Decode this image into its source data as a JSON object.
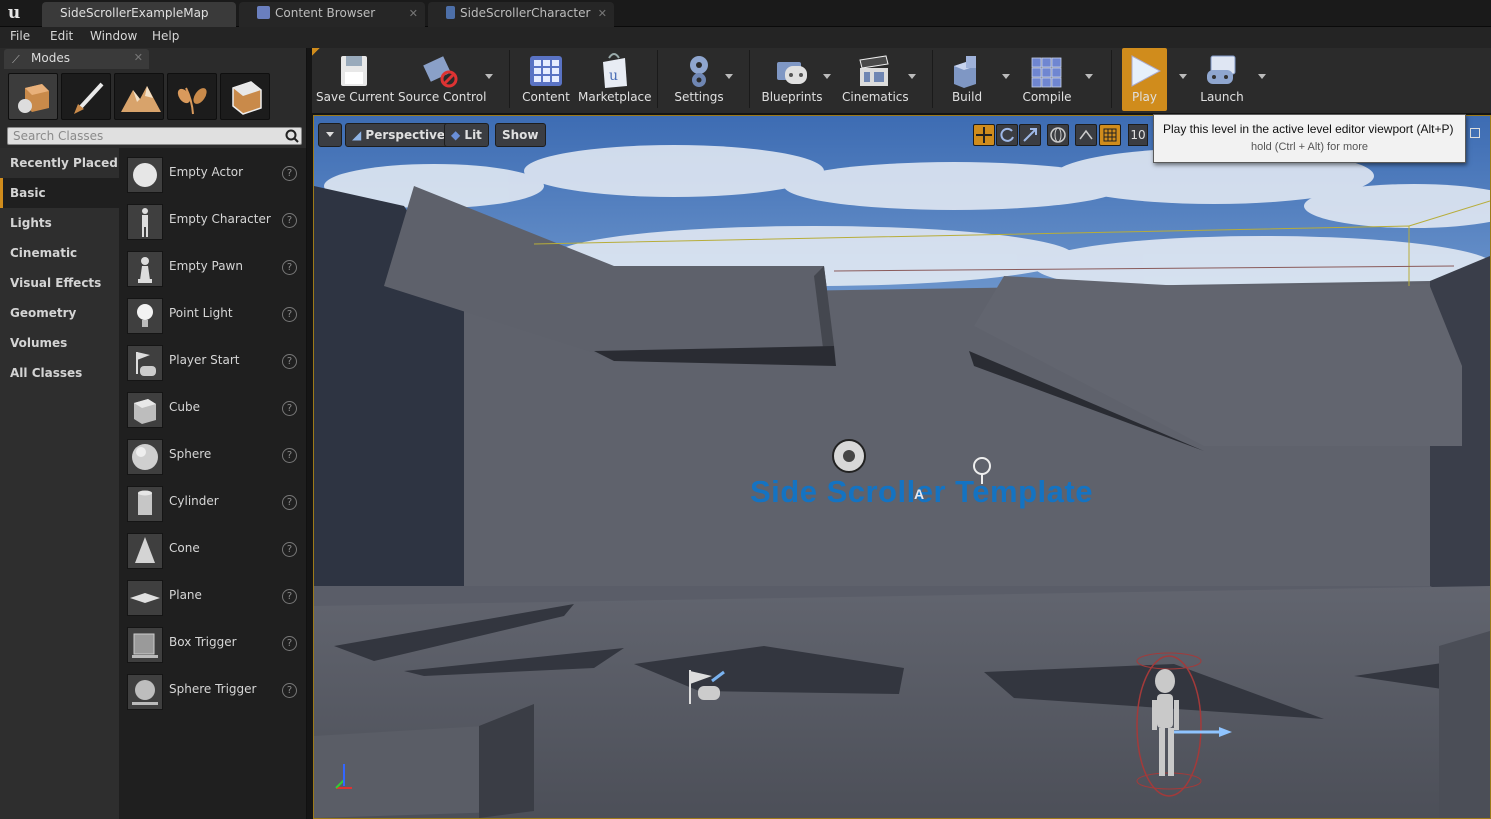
{
  "tabs": [
    {
      "label": "SideScrollerExampleMap",
      "active": true
    },
    {
      "label": "Content Browser",
      "active": false
    },
    {
      "label": "SideScrollerCharacter",
      "active": false
    }
  ],
  "menu": [
    "File",
    "Edit",
    "Window",
    "Help"
  ],
  "modes": {
    "title": "Modes",
    "search_placeholder": "Search Classes",
    "categories": [
      "Recently Placed",
      "Basic",
      "Lights",
      "Cinematic",
      "Visual Effects",
      "Geometry",
      "Volumes",
      "All Classes"
    ],
    "selected_category": "Basic",
    "items": [
      "Empty Actor",
      "Empty Character",
      "Empty Pawn",
      "Point Light",
      "Player Start",
      "Cube",
      "Sphere",
      "Cylinder",
      "Cone",
      "Plane",
      "Box Trigger",
      "Sphere Trigger"
    ],
    "help_glyph": "?"
  },
  "toolbar": {
    "save": "Save Current",
    "source_control": "Source Control",
    "content": "Content",
    "marketplace": "Marketplace",
    "settings": "Settings",
    "blueprints": "Blueprints",
    "cinematics": "Cinematics",
    "build": "Build",
    "compile": "Compile",
    "play": "Play",
    "launch": "Launch"
  },
  "viewport": {
    "view_mode": "Perspective",
    "lit": "Lit",
    "show": "Show",
    "grid_snap": "10",
    "overlay_text": "Side Scroller Template",
    "marker_letter": "A"
  },
  "tooltip": {
    "main": "Play this level in the active level editor viewport (Alt+P)",
    "sub": "hold (Ctrl + Alt) for more"
  },
  "colors": {
    "accent": "#d08c1c",
    "overlay_text": "#1473c2"
  }
}
